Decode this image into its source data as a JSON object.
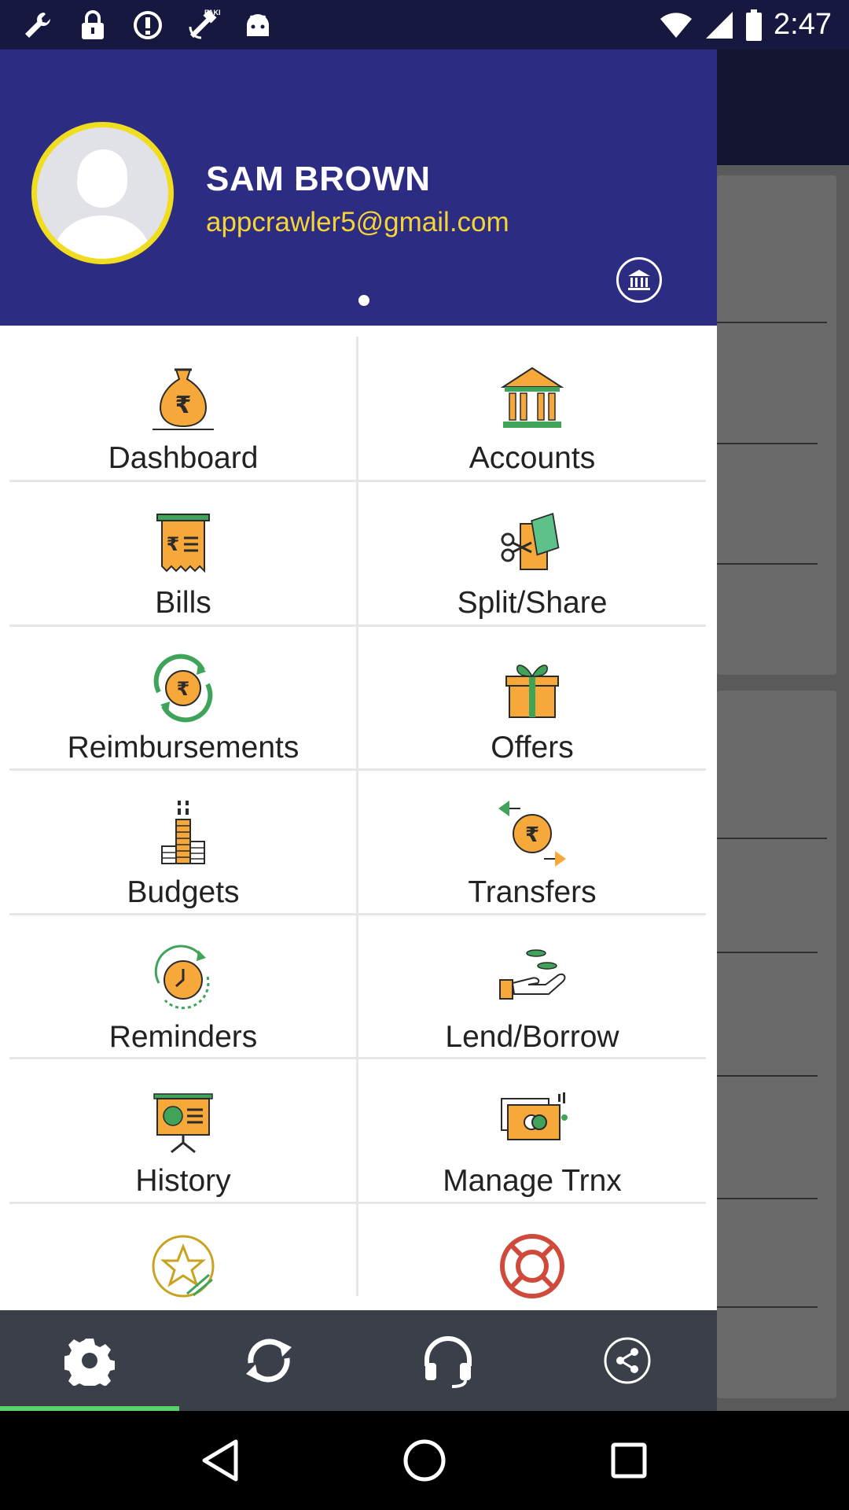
{
  "status_bar": {
    "time": "2:47",
    "icons": [
      "wrench-icon",
      "lock-icon",
      "alert-circle-icon",
      "fake-gps-icon",
      "android-icon",
      "wifi-icon",
      "signal-icon",
      "battery-icon"
    ]
  },
  "drawer": {
    "user": {
      "name": "SAM BROWN",
      "email": "appcrawler5@gmail.com"
    },
    "menu": [
      {
        "label": "Dashboard",
        "icon": "money-bag-icon"
      },
      {
        "label": "Accounts",
        "icon": "bank-icon"
      },
      {
        "label": "Bills",
        "icon": "bill-receipt-icon"
      },
      {
        "label": "Split/Share",
        "icon": "scissors-money-icon"
      },
      {
        "label": "Reimbursements",
        "icon": "rupee-refresh-icon"
      },
      {
        "label": "Offers",
        "icon": "gift-icon"
      },
      {
        "label": "Budgets",
        "icon": "coin-stack-icon"
      },
      {
        "label": "Transfers",
        "icon": "rupee-transfer-icon"
      },
      {
        "label": "Reminders",
        "icon": "clock-icon"
      },
      {
        "label": "Lend/Borrow",
        "icon": "hand-coins-icon"
      },
      {
        "label": "History",
        "icon": "presentation-chart-icon"
      },
      {
        "label": "Manage Trnx",
        "icon": "cash-card-icon"
      },
      {
        "label": "",
        "icon": "star-rate-icon"
      },
      {
        "label": "",
        "icon": "lifebuoy-icon"
      }
    ]
  },
  "bottom_bar": {
    "items": [
      "settings-icon",
      "sync-icon",
      "headset-icon",
      "share-icon"
    ],
    "active_index": 0,
    "accent": "#5ad26b"
  },
  "colors": {
    "header_bg": "#2c2c83",
    "icon_orange": "#f6a83b",
    "icon_green": "#3fa35a"
  }
}
